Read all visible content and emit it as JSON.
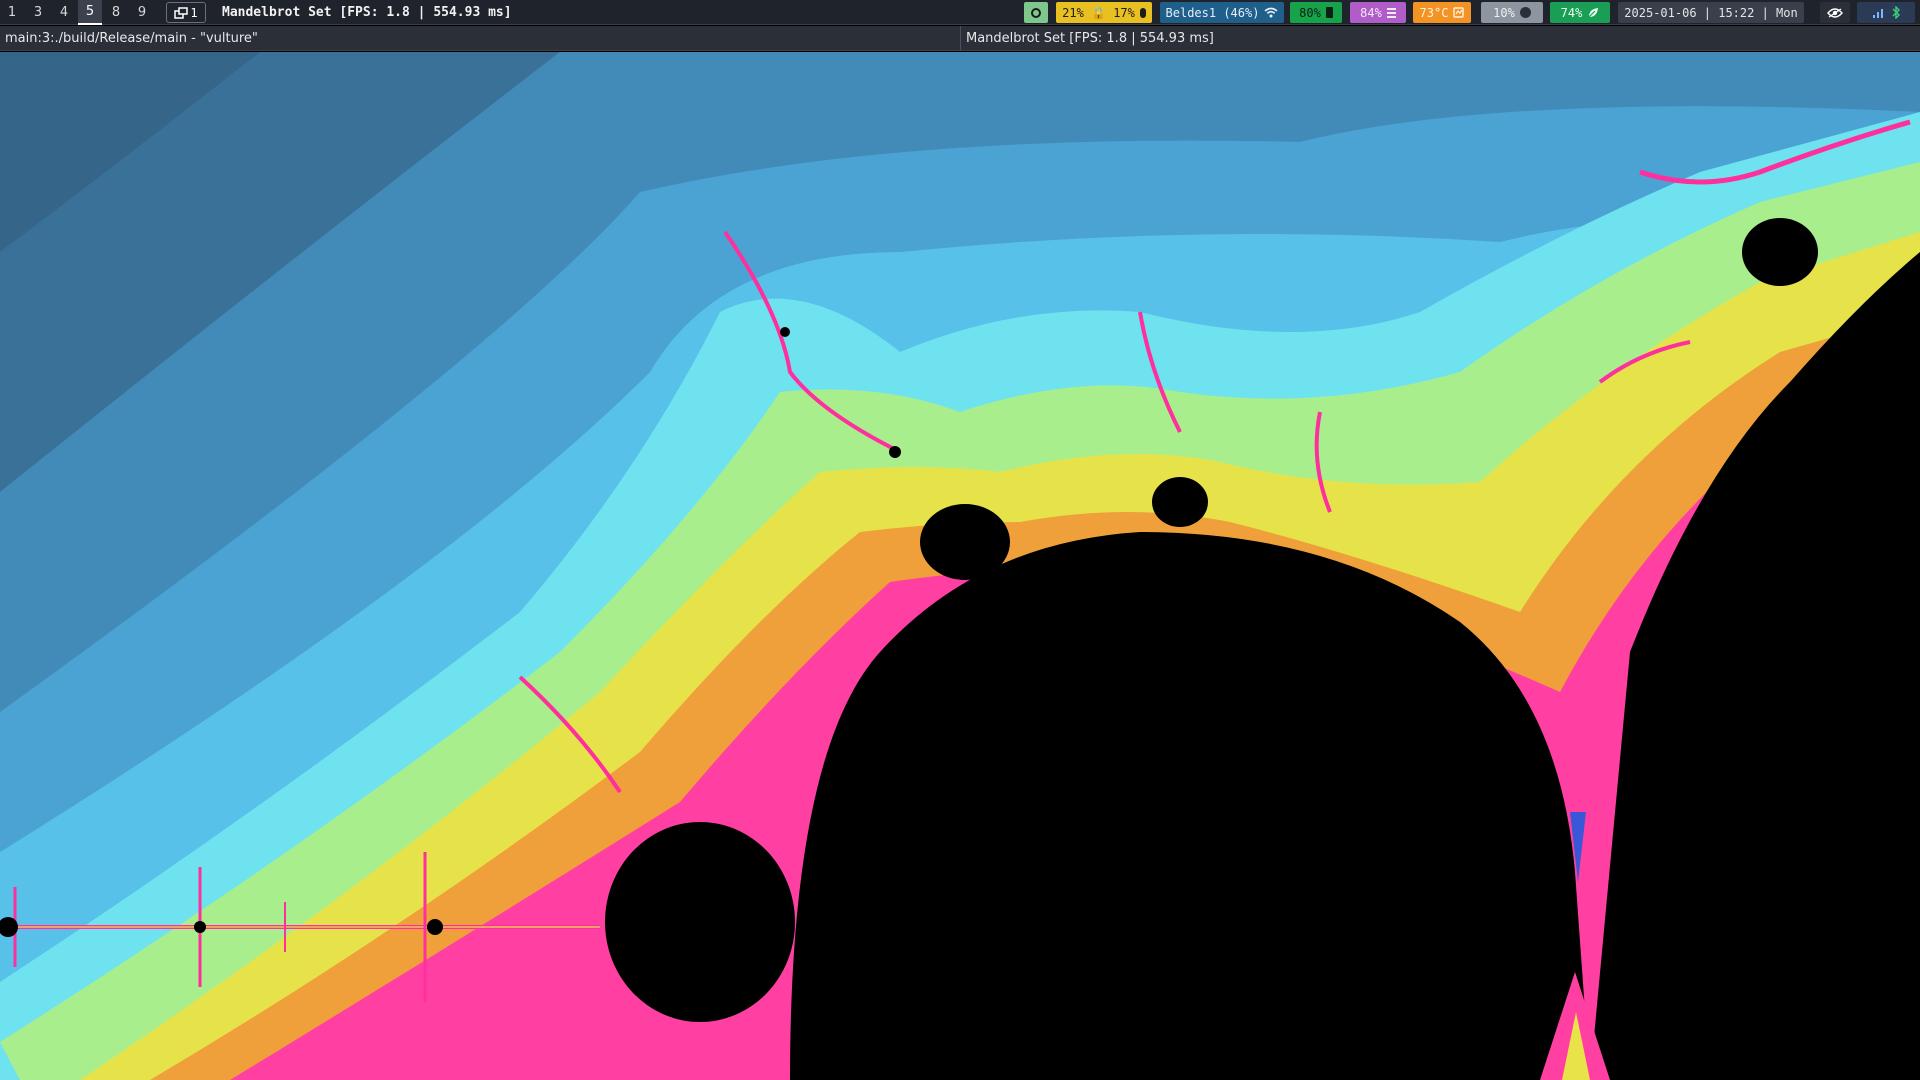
{
  "topbar": {
    "workspaces": [
      {
        "label": "1",
        "active": false
      },
      {
        "label": "3",
        "active": false
      },
      {
        "label": "4",
        "active": false
      },
      {
        "label": "5",
        "active": true
      },
      {
        "label": "8",
        "active": false
      },
      {
        "label": "9",
        "active": false
      }
    ],
    "layout_label": "1",
    "window_title": "Mandelbrot Set [FPS: 1.8 | 554.93 ms]",
    "modules": {
      "audio": "21% 🔒 17%",
      "wifi": "Beldes1 (46%)",
      "battery": "80%",
      "memory": "84%",
      "temperature": "73°C",
      "brightness": "10%",
      "eco": "74%",
      "datetime": "2025-01-06 | 15:22 | Mon"
    }
  },
  "subbar": {
    "left_window": "main:3:./build/Release/main - \"vulture\"",
    "right_window": "Mandelbrot Set [FPS: 1.8 | 554.93 ms]"
  },
  "icons": {
    "status-dot": "circle-icon",
    "layout": "window-stack-icon",
    "mic": "microphone-icon",
    "wifi": "wifi-icon",
    "battery": "battery-icon",
    "memory": "menu-bars-icon",
    "temperature": "thermometer-icon",
    "brightness": "moon-icon",
    "eco": "leaf-icon",
    "eye": "eye-icon",
    "tray": "network-signal-icon"
  },
  "colors": {
    "bar_bg": "#1f232b",
    "fractal_outer": "#3b7aa6",
    "fractal_cyan": "#5fd8f0",
    "fractal_yellow": "#e9e34a",
    "fractal_magenta": "#ff2f9e",
    "set_interior": "#000000"
  }
}
